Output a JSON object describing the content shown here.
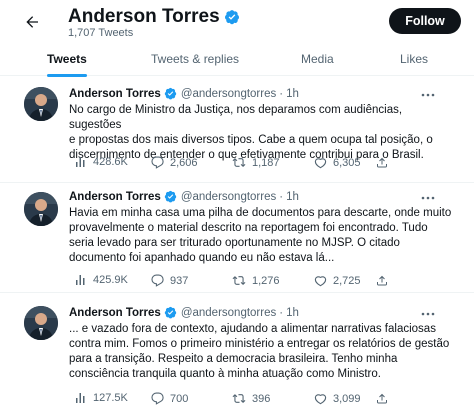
{
  "header": {
    "profile_name": "Anderson Torres",
    "tweet_count": "1,707 Tweets",
    "follow_label": "Follow"
  },
  "tabs": [
    {
      "label": "Tweets",
      "active": true
    },
    {
      "label": "Tweets & replies",
      "active": false
    },
    {
      "label": "Media",
      "active": false
    },
    {
      "label": "Likes",
      "active": false
    }
  ],
  "tweets": [
    {
      "name": "Anderson Torres",
      "handle": "@andersongtorres",
      "separator": "·",
      "time": "1h",
      "text": "No cargo de Ministro da Justiça, nos deparamos com audiências, sugestões\ne propostas dos mais diversos tipos. Cabe a quem ocupa tal posição, o\ndiscernimento de entender o que efetivamente contribui para o Brasil.",
      "views": "428.6K",
      "replies": "2,606",
      "retweets": "1,187",
      "likes": "6,305"
    },
    {
      "name": "Anderson Torres",
      "handle": "@andersongtorres",
      "separator": "·",
      "time": "1h",
      "text": "Havia em minha casa uma pilha de documentos para descarte, onde muito\nprovavelmente o material descrito na reportagem foi encontrado. Tudo\nseria levado para ser triturado oportunamente no MJSP. O citado\ndocumento foi apanhado quando eu não estava lá...",
      "views": "425.9K",
      "replies": "937",
      "retweets": "1,276",
      "likes": "2,725"
    },
    {
      "name": "Anderson Torres",
      "handle": "@andersongtorres",
      "separator": "·",
      "time": "1h",
      "text": "... e vazado fora de contexto, ajudando a alimentar narrativas falaciosas\ncontra mim. Fomos o primeiro ministério a entregar os relatórios de gestão\npara a transição. Respeito a democracia brasileira. Tenho minha\nconsciência tranquila quanto à minha atuação como Ministro.",
      "views": "127.5K",
      "replies": "700",
      "retweets": "396",
      "likes": "3,099"
    }
  ],
  "colors": {
    "accent": "#1d9bf0",
    "text_primary": "#0f1419",
    "text_secondary": "#536471",
    "follow_bg": "#0f1419",
    "divider": "#eff3f4"
  },
  "icons": [
    "back-arrow-icon",
    "verified-badge-icon",
    "more-options-icon",
    "views-icon",
    "reply-icon",
    "retweet-icon",
    "like-icon",
    "share-icon"
  ]
}
